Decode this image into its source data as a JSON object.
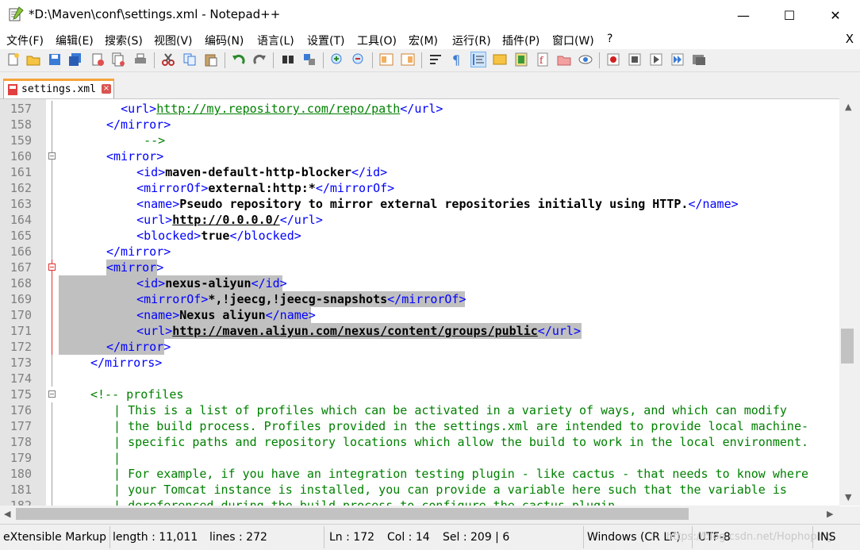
{
  "window": {
    "title": "*D:\\Maven\\conf\\settings.xml - Notepad++",
    "minimize": "—",
    "maximize": "☐",
    "close": "✕"
  },
  "menu": {
    "items": [
      "文件(F)",
      "编辑(E)",
      "搜索(S)",
      "视图(V)",
      "编码(N)",
      "语言(L)",
      "设置(T)",
      "工具(O)",
      "宏(M)",
      "运行(R)",
      "插件(P)",
      "窗口(W)",
      "?"
    ],
    "close": "X"
  },
  "tab": {
    "label": "settings.xml",
    "close": "×"
  },
  "editor": {
    "current_line": 172,
    "lines": [
      {
        "n": "157",
        "segs": [
          [
            "  ",
            ""
          ],
          [
            "<url>",
            "tag"
          ],
          [
            "http://my.repository.com/repo/path",
            "lnk-url"
          ],
          [
            "</url>",
            "tag"
          ]
        ]
      },
      {
        "n": "158",
        "segs": [
          [
            "</mirror>",
            "tag"
          ]
        ]
      },
      {
        "n": "159",
        "segs": [
          [
            "   -->",
            "cmt"
          ]
        ]
      },
      {
        "n": "160",
        "segs": [
          [
            "<mirror>",
            "tag"
          ]
        ]
      },
      {
        "n": "161",
        "segs": [
          [
            "  ",
            ""
          ],
          [
            "<id>",
            "tag"
          ],
          [
            "maven-default-http-blocker",
            "val"
          ],
          [
            "</id>",
            "tag"
          ]
        ]
      },
      {
        "n": "162",
        "segs": [
          [
            "  ",
            ""
          ],
          [
            "<mirrorOf>",
            "tag"
          ],
          [
            "external:http:*",
            "val"
          ],
          [
            "</mirrorOf>",
            "tag"
          ]
        ]
      },
      {
        "n": "163",
        "segs": [
          [
            "  ",
            ""
          ],
          [
            "<name>",
            "tag"
          ],
          [
            "Pseudo repository to mirror external repositories initially using HTTP.",
            "val"
          ],
          [
            "</name>",
            "tag"
          ]
        ]
      },
      {
        "n": "164",
        "segs": [
          [
            "  ",
            ""
          ],
          [
            "<url>",
            "tag"
          ],
          [
            "http://0.0.0.0/",
            "lnk"
          ],
          [
            "</url>",
            "tag"
          ]
        ]
      },
      {
        "n": "165",
        "segs": [
          [
            "  ",
            ""
          ],
          [
            "<blocked>",
            "tag"
          ],
          [
            "true",
            "val"
          ],
          [
            "</blocked>",
            "tag"
          ]
        ]
      },
      {
        "n": "166",
        "segs": [
          [
            "</mirror>",
            "tag"
          ]
        ]
      },
      {
        "n": "167",
        "segs": [
          [
            "<mirror>",
            "tag"
          ]
        ]
      },
      {
        "n": "168",
        "segs": [
          [
            "  ",
            ""
          ],
          [
            "<id>",
            "tag"
          ],
          [
            "nexus-aliyun",
            "val"
          ],
          [
            "</id>",
            "tag"
          ]
        ]
      },
      {
        "n": "169",
        "segs": [
          [
            "  ",
            ""
          ],
          [
            "<mirrorOf>",
            "tag"
          ],
          [
            "*,!jeecg,!jeecg-snapshots",
            "val"
          ],
          [
            "</mirrorOf>",
            "tag"
          ]
        ]
      },
      {
        "n": "170",
        "segs": [
          [
            "  ",
            ""
          ],
          [
            "<name>",
            "tag"
          ],
          [
            "Nexus aliyun",
            "val"
          ],
          [
            "</name>",
            "tag"
          ]
        ]
      },
      {
        "n": "171",
        "segs": [
          [
            "  ",
            ""
          ],
          [
            "<url>",
            "tag"
          ],
          [
            "http://maven.aliyun.com/nexus/content/groups/public",
            "lnk"
          ],
          [
            "</url>",
            "tag"
          ]
        ]
      },
      {
        "n": "172",
        "segs": [
          [
            "</mirror>",
            "tag"
          ]
        ]
      },
      {
        "n": "173",
        "segs": [
          [
            "</mirrors>",
            "tag"
          ]
        ]
      },
      {
        "n": "174",
        "segs": []
      },
      {
        "n": "175",
        "segs": [
          [
            "<!-- profiles",
            "cmt"
          ]
        ]
      },
      {
        "n": "176",
        "segs": [
          [
            " | This is a list of profiles which can be activated in a variety of ways, and which can modify",
            "cmt"
          ]
        ]
      },
      {
        "n": "177",
        "segs": [
          [
            " | the build process. Profiles provided in the settings.xml are intended to provide local machine-",
            "cmt"
          ]
        ]
      },
      {
        "n": "178",
        "segs": [
          [
            " | specific paths and repository locations which allow the build to work in the local environment.",
            "cmt"
          ]
        ]
      },
      {
        "n": "179",
        "segs": [
          [
            " |",
            "cmt"
          ]
        ]
      },
      {
        "n": "180",
        "segs": [
          [
            " | For example, if you have an integration testing plugin - like cactus - that needs to know where",
            "cmt"
          ]
        ]
      },
      {
        "n": "181",
        "segs": [
          [
            " | your Tomcat instance is installed, you can provide a variable here such that the variable is",
            "cmt"
          ]
        ]
      },
      {
        "n": "182",
        "segs": [
          [
            " | dereferenced during the build process to configure the cactus plugin.",
            "cmt"
          ]
        ]
      }
    ]
  },
  "status": {
    "lang": "eXtensible Markup",
    "length": "length : 11,011",
    "lines": "lines : 272",
    "ln": "Ln : 172",
    "col": "Col : 14",
    "sel": "Sel : 209 | 6",
    "eol": "Windows (CR LF)",
    "enc": "UTF-8",
    "mode": "INS",
    "watermark": "https://blog.csdn.net/Hophoping"
  }
}
